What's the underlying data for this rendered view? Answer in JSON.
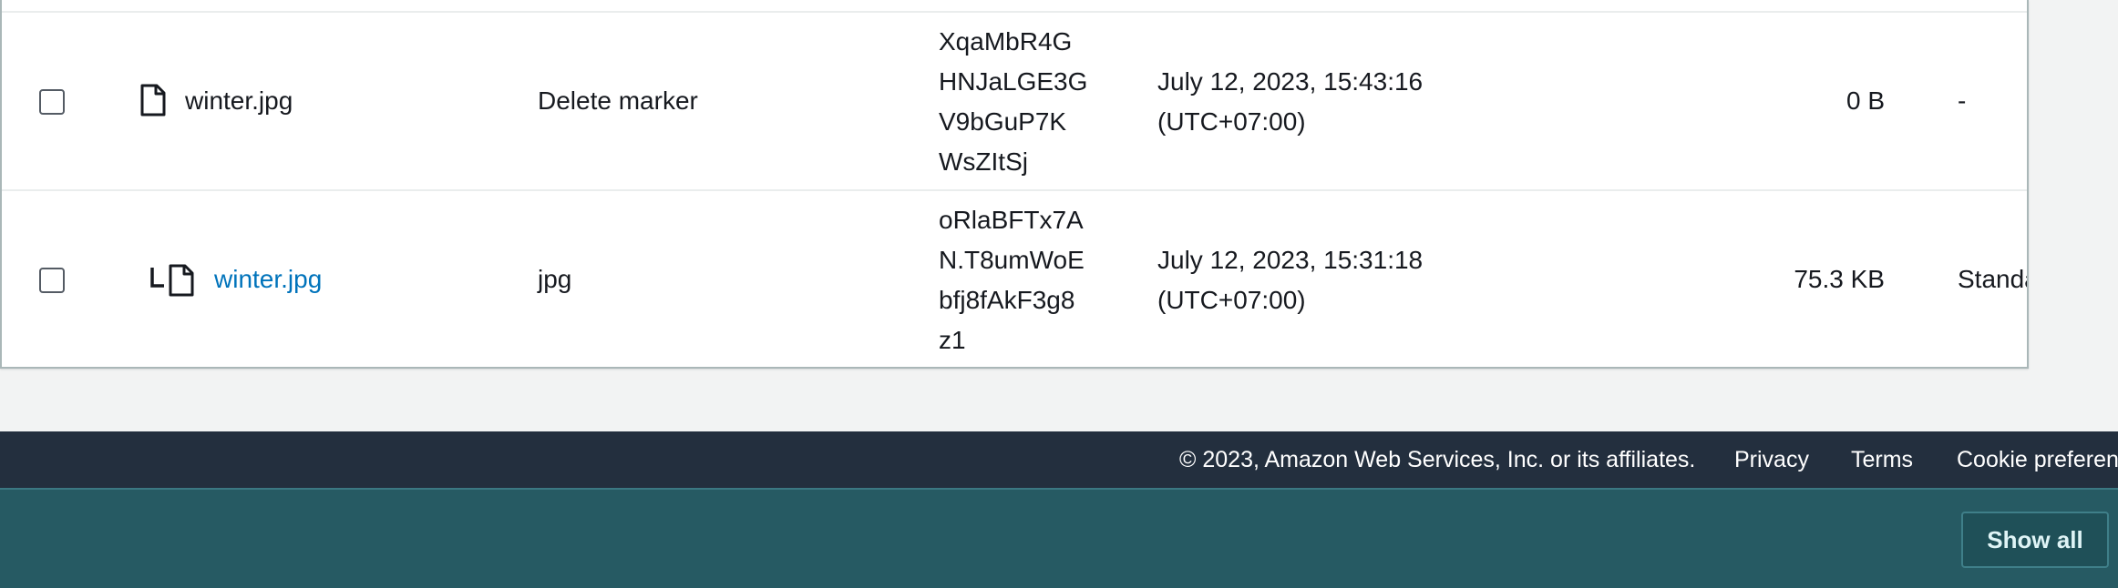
{
  "table": {
    "rows": [
      {
        "name": "winter.jpg",
        "type": "Delete marker",
        "version_id_lines": [
          "XqaMbR4G",
          "HNJaLGE3G",
          "V9bGuP7K",
          "WsZItSj"
        ],
        "last_modified_line1": "July 12, 2023, 15:43:16",
        "last_modified_line2": "(UTC+07:00)",
        "size": "0 B",
        "storage_class": "-",
        "is_link": false,
        "icon": "file-icon"
      },
      {
        "name": "winter.jpg",
        "type": "jpg",
        "version_id_lines": [
          "oRlaBFTx7A",
          "N.T8umWoE",
          "bfj8fAkF3g8",
          "z1"
        ],
        "last_modified_line1": "July 12, 2023, 15:31:18",
        "last_modified_line2": "(UTC+07:00)",
        "size": "75.3 KB",
        "storage_class": "Standa",
        "is_link": true,
        "icon": "file-icon",
        "version_connector_icon": "version-branch-icon"
      }
    ]
  },
  "footer": {
    "copyright": "© 2023, Amazon Web Services, Inc. or its affiliates.",
    "privacy": "Privacy",
    "terms": "Terms",
    "cookie": "Cookie preferenc"
  },
  "bottom_bar": {
    "show_all_label": "Show all"
  },
  "colors": {
    "link": "#0073bb",
    "footer_bg": "#232f3e",
    "bottom_band_bg": "#265a63",
    "page_bg": "#f2f3f3"
  }
}
